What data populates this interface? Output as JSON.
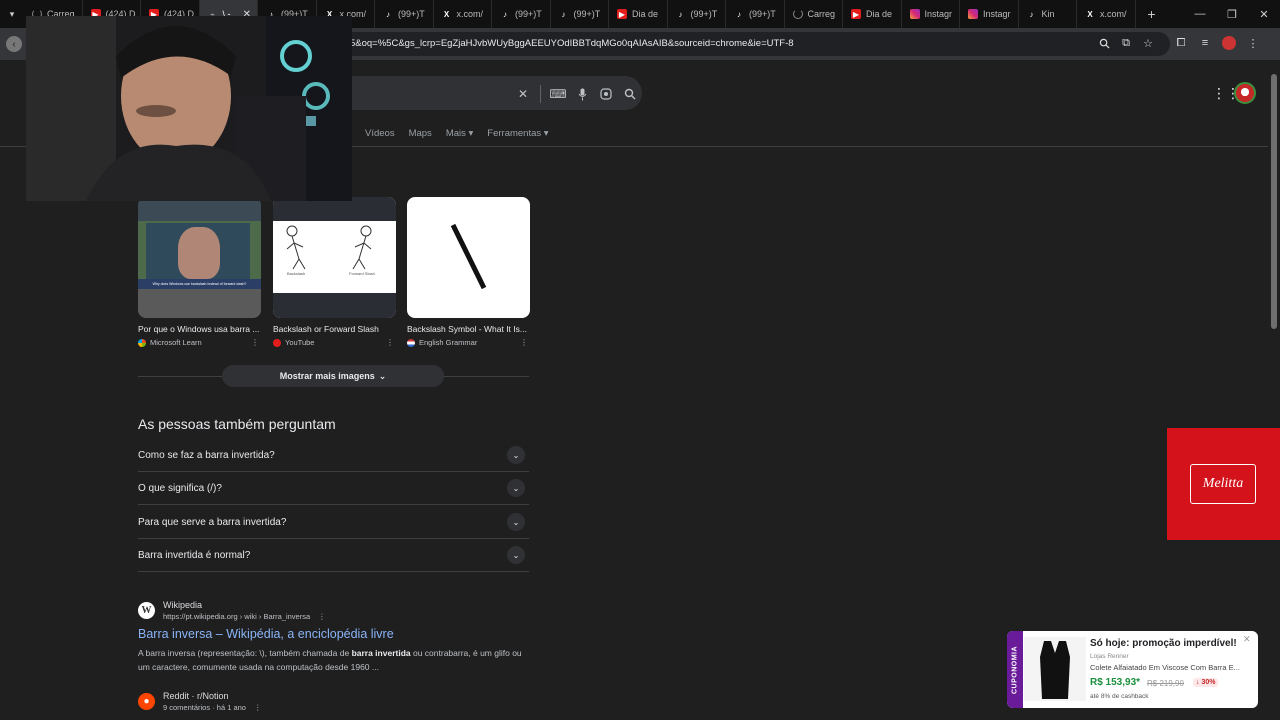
{
  "browser": {
    "tabs": [
      {
        "label": "Carreg",
        "icon": "loading-icon",
        "active": false
      },
      {
        "label": "(424) D",
        "icon": "youtube-icon",
        "active": false
      },
      {
        "label": "(424) D",
        "icon": "youtube-icon",
        "active": false
      },
      {
        "label": "\\ -",
        "icon": "google-icon",
        "active": true
      },
      {
        "label": "(99+)T",
        "icon": "tiktok-icon",
        "active": false
      },
      {
        "label": "x.com/",
        "icon": "x-icon",
        "active": false
      },
      {
        "label": "(99+)T",
        "icon": "tiktok-icon",
        "active": false
      },
      {
        "label": "x.com/",
        "icon": "x-icon",
        "active": false
      },
      {
        "label": "(99+)T",
        "icon": "tiktok-icon",
        "active": false
      },
      {
        "label": "(99+)T",
        "icon": "tiktok-icon",
        "active": false
      },
      {
        "label": "Dia de",
        "icon": "youtube-icon",
        "active": false
      },
      {
        "label": "(99+)T",
        "icon": "tiktok-icon",
        "active": false
      },
      {
        "label": "(99+)T",
        "icon": "tiktok-icon",
        "active": false
      },
      {
        "label": "Carreg",
        "icon": "loading-icon",
        "active": false
      },
      {
        "label": "Dia de",
        "icon": "youtube-icon",
        "active": false
      },
      {
        "label": "Instagr",
        "icon": "instagram-icon",
        "active": false
      },
      {
        "label": "Instagr",
        "icon": "instagram-icon",
        "active": false
      },
      {
        "label": "Kin",
        "icon": "tiktok-icon",
        "active": false
      },
      {
        "label": "x.com/",
        "icon": "x-icon",
        "active": false
      }
    ],
    "url": "5&oq=%5C&gs_lcrp=EgZjaHJvbWUyBggAEEUYOdIBBTdqMGo0qAIAsAIB&sourceid=chrome&ie=UTF-8"
  },
  "search": {
    "nav_tabs": [
      "Vídeos",
      "Maps",
      "Mais ▾",
      "Ferramentas ▾"
    ]
  },
  "images": [
    {
      "caption": "Por que o Windows usa barra ...",
      "source": "Microsoft Learn",
      "thumb_text": "Why does Windows use backslash instead of forward slash?"
    },
    {
      "caption": "Backslash or Forward Slash",
      "source": "YouTube",
      "left_label": "Backslash",
      "right_label": "Forward Slash"
    },
    {
      "caption": "Backslash Symbol - What It Is...",
      "source": "English Grammar",
      "glyph": "\\"
    }
  ],
  "more_images_label": "Mostrar mais imagens",
  "paa": {
    "title": "As pessoas também perguntam",
    "questions": [
      "Como se faz a barra invertida?",
      "O que significa (/)?",
      "Para que serve a barra invertida?",
      "Barra invertida é normal?"
    ]
  },
  "results": [
    {
      "site": "Wikipedia",
      "url": "https://pt.wikipedia.org › wiki › Barra_inversa",
      "title": "Barra inversa – Wikipédia, a enciclopédia livre",
      "snippet_pre": "A barra inversa (representação: \\), também chamada de ",
      "snippet_bold1": "barra invertida",
      "snippet_mid": " ou contrabarra, é um glifo ou um caractere, comumente usada na computação desde 1960 ..."
    },
    {
      "site": "Reddit · r/Notion",
      "meta": "9 comentários · há 1 ano"
    }
  ],
  "ad": {
    "brand": "Melitta"
  },
  "promo": {
    "tag": "CUPONOMIA",
    "headline": "Só hoje: promoção imperdível!",
    "store": "Lojas Renner",
    "product": "Colete Alfaiatado Em Viscose Com Barra E...",
    "price": "R$ 153,93*",
    "old_price": "R$ 219,90",
    "discount": "↓ 30%",
    "cashback": "até 8% de cashback"
  },
  "colors": {
    "link": "#8ab4f8",
    "background": "#1f1f1f",
    "ad_red": "#d3121b"
  }
}
